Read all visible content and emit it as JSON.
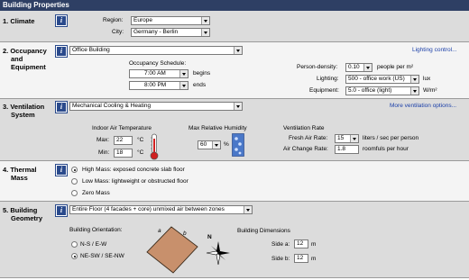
{
  "title": "Building Properties",
  "climate": {
    "heading": "1. Climate",
    "region_label": "Region:",
    "region_value": "Europe",
    "city_label": "City:",
    "city_value": "Germany - Berlin"
  },
  "occupancy": {
    "heading_line1": "2. Occupancy",
    "heading_line2": "and",
    "heading_line3": "Equipment",
    "building_type": "Office Building",
    "link": "Lighting control...",
    "schedule_label": "Occupancy Schedule:",
    "begin_time": "7:00 AM",
    "begins_label": "begins",
    "end_time": "8:00 PM",
    "ends_label": "ends",
    "person_density_label": "Person-density:",
    "person_density_value": "0.10",
    "person_density_unit": "people per m²",
    "lighting_label": "Lighting:",
    "lighting_value": "500 - office work (US)",
    "lighting_unit": "lux",
    "equipment_label": "Equipment:",
    "equipment_value": "5.0 - office (light)",
    "equipment_unit": "W/m²"
  },
  "ventilation": {
    "heading_line1": "3. Ventilation",
    "heading_line2": "System",
    "system_value": "Mechanical Cooling & Heating",
    "link": "More ventilation options...",
    "indoor_temp_label": "Indoor Air Temperature",
    "max_label": "Max:",
    "max_value": "22",
    "min_label": "Min:",
    "min_value": "18",
    "temp_unit": "°C",
    "humidity_label": "Max Relative Humidity",
    "humidity_value": "60",
    "humidity_unit": "%",
    "rate_label": "Ventilation Rate",
    "fresh_air_label": "Fresh Air Rate:",
    "fresh_air_value": "15",
    "fresh_air_unit": "liters / sec per person",
    "air_change_label": "Air Change Rate:",
    "air_change_value": "1.8",
    "air_change_unit": "roomfuls per hour"
  },
  "thermal": {
    "heading_line1": "4. Thermal",
    "heading_line2": "Mass",
    "options": [
      {
        "label": "High Mass: exposed concrete slab floor",
        "selected": true
      },
      {
        "label": "Low Mass: lightweight or obstructed floor",
        "selected": false
      },
      {
        "label": "Zero Mass",
        "selected": false
      }
    ]
  },
  "geometry": {
    "heading_line1": "5. Building",
    "heading_line2": "Geometry",
    "floor_value": "Entire Floor (4 facades + core) unmixed air between zones",
    "orientation_label": "Building Orientation:",
    "orientation_options": [
      {
        "label": "N-S / E-W",
        "selected": false
      },
      {
        "label": "NE-SW / SE-NW",
        "selected": true
      }
    ],
    "side_a_letter": "a",
    "side_b_letter": "b",
    "compass_n": "N",
    "dimensions_label": "Building Dimensions",
    "side_a_label": "Side a:",
    "side_a_value": "12",
    "side_b_label": "Side b:",
    "side_b_value": "12",
    "dim_unit": "m"
  },
  "colors": {
    "titlebar": "#2e3f64",
    "section_gray": "#dcdcdc",
    "link": "#1a3fa8",
    "building_fill": "#c8906c",
    "thermometer_red": "#d02020"
  }
}
